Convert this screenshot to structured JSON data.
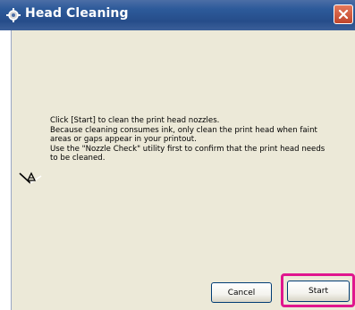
{
  "window": {
    "title": "Head Cleaning",
    "title_icon": "printer-gear-icon",
    "close_icon": "close-icon"
  },
  "message": {
    "icon": "print-head-nozzle-icon",
    "lines": [
      "Click [Start] to clean the print head nozzles.",
      "Because cleaning consumes ink, only clean the print head when faint",
      "areas or gaps appear in your printout.",
      "Use the \"Nozzle Check\" utility first to confirm that the print head needs",
      "to be cleaned."
    ]
  },
  "buttons": {
    "cancel_label": "Cancel",
    "start_label": "Start"
  },
  "colors": {
    "titlebar": "#2d5a9a",
    "dialog_bg": "#ece9d8",
    "highlight": "#e0168e"
  }
}
